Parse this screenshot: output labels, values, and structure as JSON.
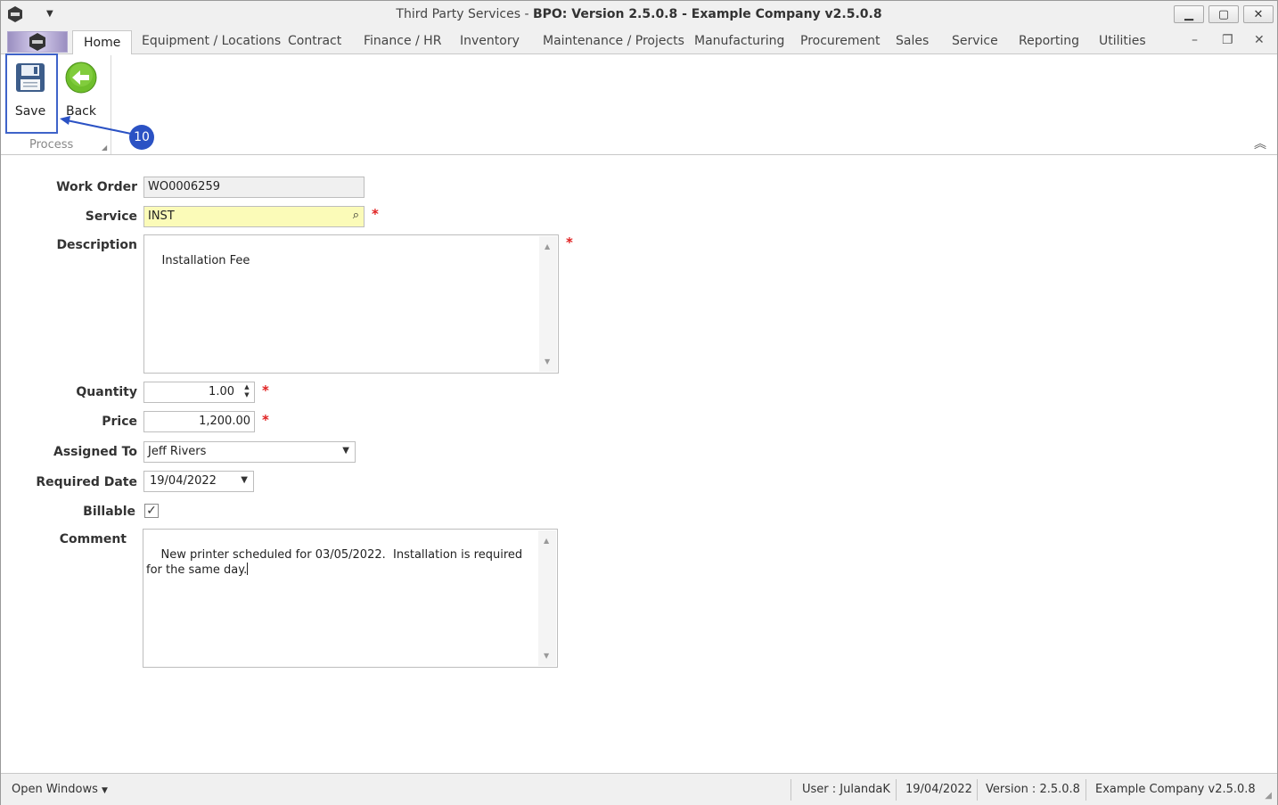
{
  "window": {
    "title_prefix": "Third Party Services",
    "title_bold": "BPO: Version 2.5.0.8 - Example Company v2.5.0.8",
    "title_sep": " - "
  },
  "tabs": [
    {
      "label": "Home",
      "active": true
    },
    {
      "label": "Equipment / Locations"
    },
    {
      "label": "Contract"
    },
    {
      "label": "Finance / HR"
    },
    {
      "label": "Inventory"
    },
    {
      "label": "Maintenance / Projects"
    },
    {
      "label": "Manufacturing"
    },
    {
      "label": "Procurement"
    },
    {
      "label": "Sales"
    },
    {
      "label": "Service"
    },
    {
      "label": "Reporting"
    },
    {
      "label": "Utilities"
    }
  ],
  "ribbon": {
    "save_label": "Save",
    "back_label": "Back",
    "group_label": "Process",
    "callout_number": "10"
  },
  "form": {
    "work_order_label": "Work Order",
    "work_order_value": "WO0006259",
    "service_label": "Service",
    "service_value": "INST",
    "description_label": "Description",
    "description_value": "Installation Fee",
    "quantity_label": "Quantity",
    "quantity_value": "1.00",
    "price_label": "Price",
    "price_value": "1,200.00",
    "assigned_to_label": "Assigned To",
    "assigned_to_value": "Jeff Rivers",
    "required_date_label": "Required Date",
    "required_date_value": "19/04/2022",
    "billable_label": "Billable",
    "billable_checked": true,
    "comment_label": "Comment",
    "comment_value": "New printer scheduled for 03/05/2022.  Installation is required for the same day.",
    "required_marker": "*"
  },
  "statusbar": {
    "open_windows": "Open Windows",
    "user": "User : JulandaK",
    "date": "19/04/2022",
    "version": "Version : 2.5.0.8",
    "company": "Example Company v2.5.0.8"
  },
  "colors": {
    "accent": "#3f63c9",
    "callout": "#2b52c4",
    "required": "#e02020",
    "required_field_bg": "#fbfbb8"
  }
}
